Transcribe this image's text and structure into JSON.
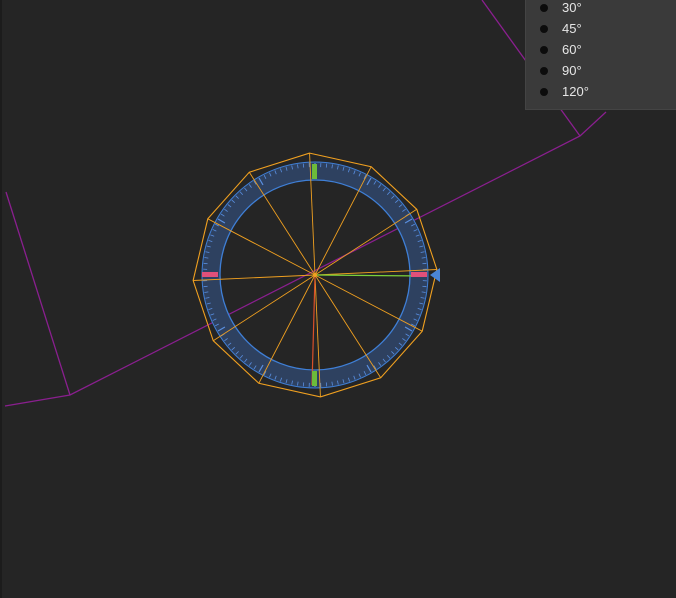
{
  "viewport": {
    "background": "#252525"
  },
  "snap_menu": {
    "options": [
      {
        "label": "30°"
      },
      {
        "label": "45°"
      },
      {
        "label": "60°"
      },
      {
        "label": "90°"
      },
      {
        "label": "120°"
      }
    ]
  },
  "gizmo": {
    "ring_color": "#3f7fd6",
    "polygon_color": "#f0a020",
    "x_handle_color": "#e0507a",
    "y_handle_color": "#6dbb3a",
    "pointer_icon": "triangle-pointer-icon"
  },
  "scene_lines": {
    "color": "#8a1f8f"
  }
}
